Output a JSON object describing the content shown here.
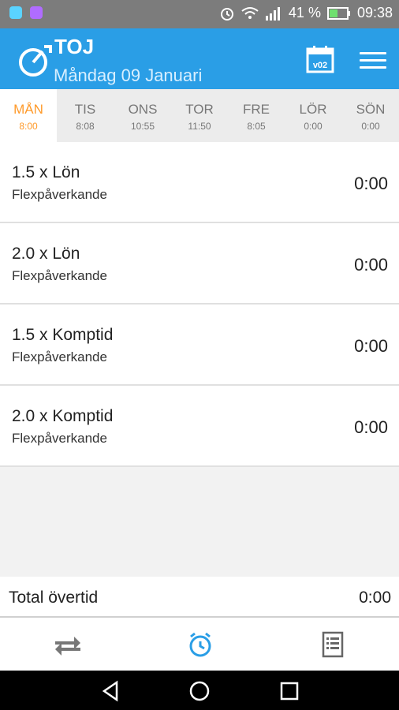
{
  "status": {
    "battery": "41 %",
    "time": "09:38"
  },
  "appbar": {
    "title": "TOJ",
    "date": "Måndag 09 Januari",
    "calendar_badge": "v02"
  },
  "tabs": [
    {
      "day": "MÅN",
      "time": "8:00"
    },
    {
      "day": "TIS",
      "time": "8:08"
    },
    {
      "day": "ONS",
      "time": "10:55"
    },
    {
      "day": "TOR",
      "time": "11:50"
    },
    {
      "day": "FRE",
      "time": "8:05"
    },
    {
      "day": "LÖR",
      "time": "0:00"
    },
    {
      "day": "SÖN",
      "time": "0:00"
    }
  ],
  "items": [
    {
      "title": "1.5 x Lön",
      "subtitle": "Flexpåverkande",
      "value": "0:00"
    },
    {
      "title": "2.0 x Lön",
      "subtitle": "Flexpåverkande",
      "value": "0:00"
    },
    {
      "title": "1.5 x Komptid",
      "subtitle": "Flexpåverkande",
      "value": "0:00"
    },
    {
      "title": "2.0 x Komptid",
      "subtitle": "Flexpåverkande",
      "value": "0:00"
    }
  ],
  "total": {
    "label": "Total övertid",
    "value": "0:00"
  },
  "colors": {
    "primary": "#2a9ee6",
    "active_tab": "#ff9a2a"
  },
  "bottom_nav": [
    "transfer-icon",
    "alarm-clock-icon",
    "report-list-icon"
  ]
}
